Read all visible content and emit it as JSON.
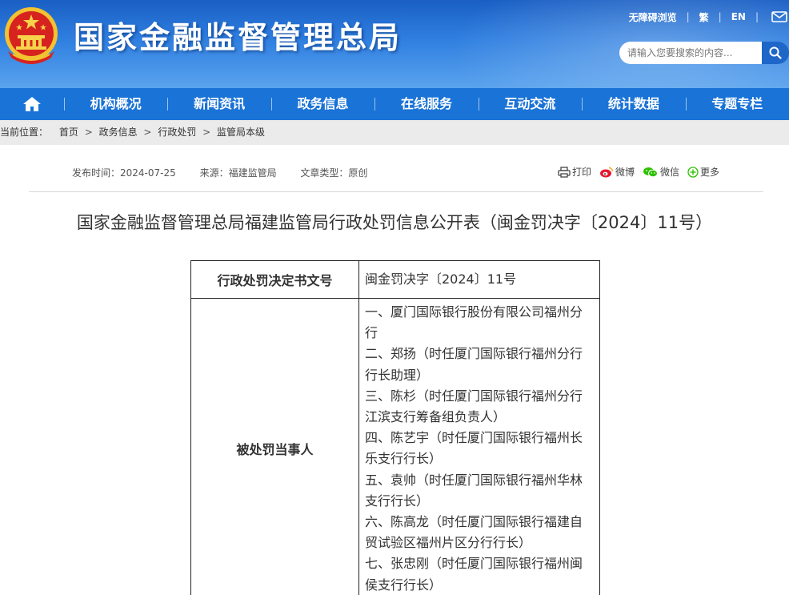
{
  "header": {
    "site_title": "国家金融监督管理总局",
    "top_links": [
      "无障碍浏览",
      "繁",
      "EN"
    ],
    "search_placeholder": "请输入您要搜索的内容..."
  },
  "nav": {
    "items": [
      "机构概况",
      "新闻资讯",
      "政务信息",
      "在线服务",
      "互动交流",
      "统计数据",
      "专题专栏"
    ]
  },
  "breadcrumb": {
    "label": "当前位置：",
    "items": [
      "首页",
      "政务信息",
      "行政处罚",
      "监管局本级"
    ]
  },
  "meta": {
    "publish_time": "发布时间：2024-07-25",
    "source": "来源：福建监管局",
    "doc_type": "文章类型：原创"
  },
  "share": {
    "print": "打印",
    "weibo": "微博",
    "wechat": "微信",
    "more": "更多"
  },
  "article": {
    "title": "国家金融监督管理总局福建监管局行政处罚信息公开表（闽金罚决字〔2024〕11号）"
  },
  "table": {
    "rows": [
      {
        "header": "行政处罚决定书文号",
        "value": "闽金罚决字〔2024〕11号"
      },
      {
        "header": "被处罚当事人",
        "parties": [
          "一、厦门国际银行股份有限公司福州分行",
          "二、郑扬（时任厦门国际银行福州分行行长助理）",
          "三、陈杉（时任厦门国际银行福州分行江滨支行筹备组负责人）",
          "四、陈艺宇（时任厦门国际银行福州长乐支行行长）",
          "五、袁帅（时任厦门国际银行福州华林支行行长）",
          "六、陈高龙（时任厦门国际银行福建自贸试验区福州片区分行行长）",
          "七、张忠刚（时任厦门国际银行福州闽侯支行行长）"
        ]
      }
    ]
  }
}
